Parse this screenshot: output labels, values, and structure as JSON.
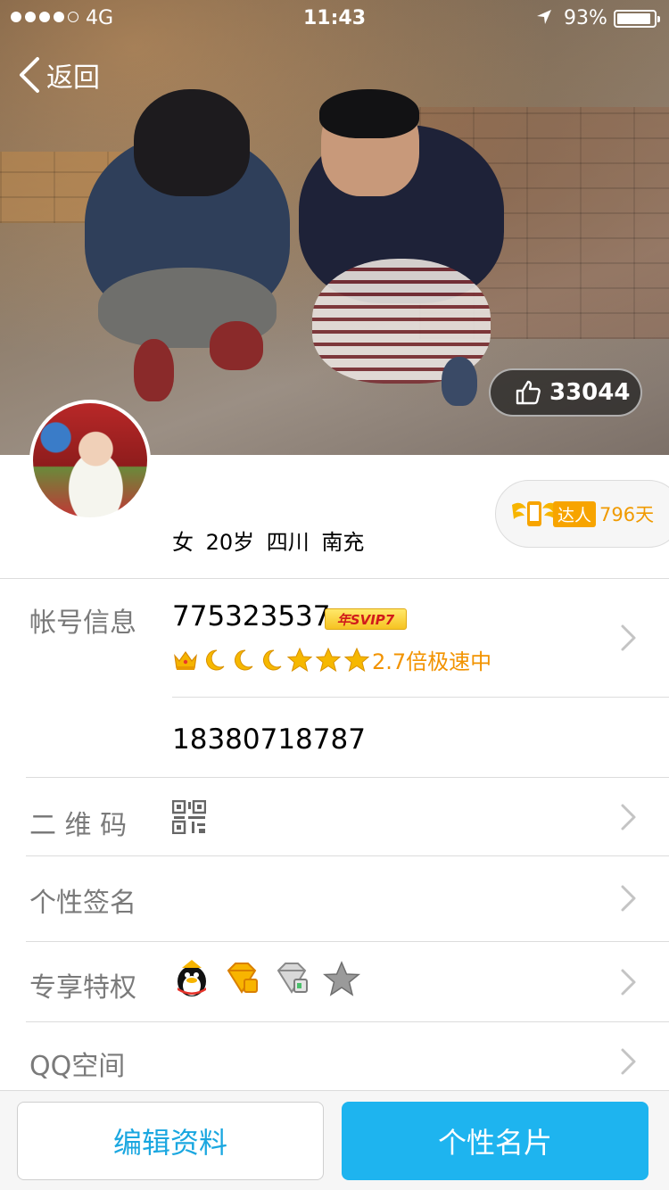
{
  "status_bar": {
    "carrier": "4G",
    "time": "11:43",
    "battery_percent": "93%",
    "battery_level": 0.93,
    "signal_bars_filled": 4,
    "signal_bars_total": 5
  },
  "nav": {
    "back_label": "返回"
  },
  "cover": {
    "like_count": "33044"
  },
  "profile": {
    "info": "女  20岁  四川 南充"
  },
  "badge": {
    "tag": "达人",
    "days": "796天"
  },
  "account": {
    "label": "帐号信息",
    "number": "775323537",
    "vip_badge": "年SVIP7",
    "level_icons": [
      "crown-icon",
      "moon-icon",
      "moon-icon",
      "moon-icon",
      "star-icon",
      "star-icon",
      "star-icon"
    ],
    "speed_text": "2.7倍极速中",
    "phone": "18380718787"
  },
  "qr": {
    "label": "二 维 码"
  },
  "signature": {
    "label": "个性签名"
  },
  "privileges": {
    "label": "专享特权",
    "icons": [
      "qq-penguin-icon",
      "yellow-diamond-icon",
      "grey-diamond-icon",
      "grey-star-icon"
    ]
  },
  "qzone": {
    "label": "QQ空间"
  },
  "bottom": {
    "edit_label": "编辑资料",
    "card_label": "个性名片"
  },
  "colors": {
    "accent": "#1eb4ef",
    "orange": "#f29300",
    "label_grey": "#7a7a7a"
  }
}
